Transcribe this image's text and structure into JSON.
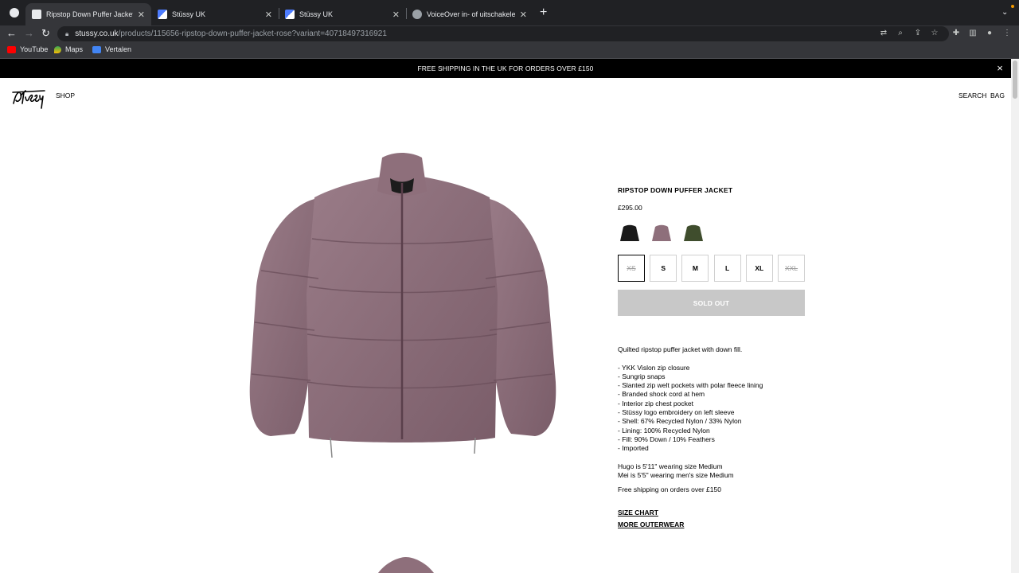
{
  "browser": {
    "tabs": [
      {
        "title": "Ripstop Down Puffer Jacket - Rose",
        "active": true
      },
      {
        "title": "Stüssy UK",
        "active": false
      },
      {
        "title": "Stüssy UK",
        "active": false
      },
      {
        "title": "VoiceOver in- of uitschakelen op Mac",
        "active": false
      }
    ],
    "url_domain": "stussy.co.uk",
    "url_path": "/products/115656-ripstop-down-puffer-jacket-rose?variant=40718497316921",
    "bookmarks": [
      "YouTube",
      "Maps",
      "Vertalen"
    ]
  },
  "promo": {
    "text": "FREE SHIPPING IN THE UK FOR ORDERS OVER £150",
    "close_icon": "×"
  },
  "header": {
    "logo": "Stüssy",
    "shop": "SHOP",
    "search": "SEARCH",
    "bag": "BAG"
  },
  "product": {
    "title": "RIPSTOP DOWN PUFFER JACKET",
    "price": "£295.00",
    "colors": [
      {
        "name": "Black",
        "hex": "#1a1a1a"
      },
      {
        "name": "Rose",
        "hex": "#8e6f7b"
      },
      {
        "name": "Olive",
        "hex": "#3f4d2d"
      }
    ],
    "sizes": [
      {
        "label": "XS",
        "available": false,
        "selected": true
      },
      {
        "label": "S",
        "available": true,
        "selected": false
      },
      {
        "label": "M",
        "available": true,
        "selected": false
      },
      {
        "label": "L",
        "available": true,
        "selected": false
      },
      {
        "label": "XL",
        "available": true,
        "selected": false
      },
      {
        "label": "XXL",
        "available": false,
        "selected": false
      }
    ],
    "cta": "SOLD OUT",
    "summary": "Quilted ripstop puffer jacket with down fill.",
    "features": [
      "- YKK Vislon zip closure",
      "- Sungrip snaps",
      "- Slanted zip welt pockets with polar fleece lining",
      "- Branded shock cord at hem",
      "- Interior zip chest pocket",
      "- Stüssy logo embroidery on left sleeve",
      "- Shell: 67% Recycled Nylon / 33% Nylon",
      "- Lining: 100% Recycled Nylon",
      "- Fill: 90% Down / 10% Feathers",
      "- Imported"
    ],
    "model_notes": [
      "Hugo is 5'11\" wearing size Medium",
      "Mei is 5'5\" wearing men's size Medium"
    ],
    "shipping_note": "Free shipping on orders over £150",
    "size_chart": "SIZE CHART",
    "more_link": "MORE OUTERWEAR"
  },
  "colors": {
    "jacket": "#8e6f7b",
    "promo_bg": "#000000",
    "soldout_bg": "#c8c8c8"
  }
}
